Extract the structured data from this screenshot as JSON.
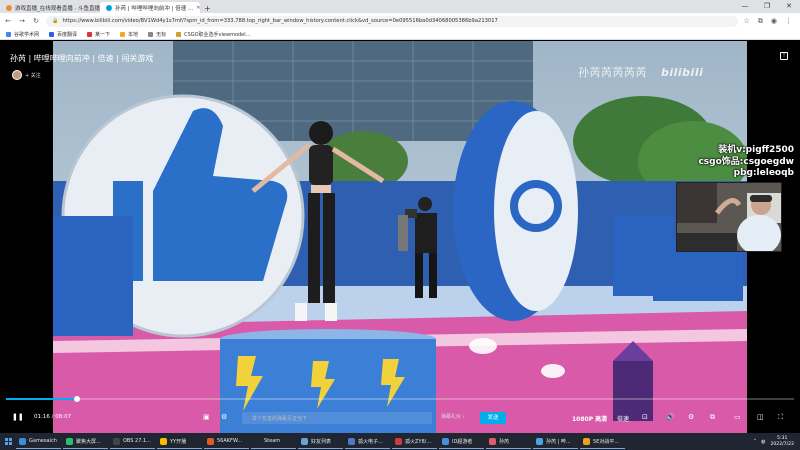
{
  "browser": {
    "tabs": [
      {
        "title": "游戏直播_在线观看直播 · 斗鱼直播 · ...",
        "favicon_color": "#f28b33"
      },
      {
        "title": "孙芮 | 哔哩哔哩向前冲 | 倍速 ...",
        "favicon_color": "#00a1d6"
      }
    ],
    "new_tab": "+",
    "window_controls": [
      "—",
      "❐",
      "✕"
    ],
    "url": "https://www.bilibili.com/video/BV1Wd4y1s7mf/?spm_id_from=333.788.top_right_bar_window_history.content.click&vd_source=0e095516ba0d34068005386b9a213017",
    "bookmarks": [
      {
        "label": "谷歌学术网",
        "color": "#4285f4"
      },
      {
        "label": "百度翻译",
        "color": "#2f5de9"
      },
      {
        "label": "某一下",
        "color": "#d33"
      },
      {
        "label": "本地",
        "color": "#f5a623"
      },
      {
        "label": "无标",
        "color": "#888"
      },
      {
        "label": "CSGO职业选手viewmodel...",
        "color": "#c9a227"
      }
    ]
  },
  "video": {
    "title": "孙芮 | 哔哩哔哩向前冲 | 倍速 | 闯关游戏",
    "follow_label": "+ 关注",
    "watermark": "孙芮芮芮芮芮",
    "logo": "bilibili",
    "overlay_lines": [
      "装机v:pigff2500",
      "csgo饰品:csgoegdw",
      "pbg:leleoqb"
    ],
    "progress": 0.09
  },
  "controls": {
    "time_current": "01:16",
    "time_total": "08:07",
    "danmaku_placeholder": "发个友善的弹幕见证当下",
    "etiquette": "弹幕礼仪 ›",
    "send_label": "发送",
    "quality": "1080P 高清",
    "speed": "倍速"
  },
  "taskbar": {
    "items": [
      {
        "label": "Gamesaich",
        "color": "#3a8fd9"
      },
      {
        "label": "聚焦大屏...",
        "color": "#2bbf6a"
      },
      {
        "label": "OBS 27.1...",
        "color": "#444"
      },
      {
        "label": "YY开播",
        "color": "#f5c000"
      },
      {
        "label": "56AKFW...",
        "color": "#e05a2a"
      },
      {
        "label": "Steam",
        "color": "#1b2838"
      },
      {
        "label": "好友列表",
        "color": "#66a3d9"
      },
      {
        "label": "孤火电子...",
        "color": "#5277c3"
      },
      {
        "label": "孤火ZY8/...",
        "color": "#c83e3e"
      },
      {
        "label": "ID超游者",
        "color": "#4a8fdc"
      },
      {
        "label": "孙芮",
        "color": "#e35a6a"
      },
      {
        "label": "孙芮 | 哔...",
        "color": "#4aa3e8"
      },
      {
        "label": "5E对战平...",
        "color": "#f0a020"
      }
    ],
    "time": "5:31",
    "date": "2022/7/22"
  }
}
